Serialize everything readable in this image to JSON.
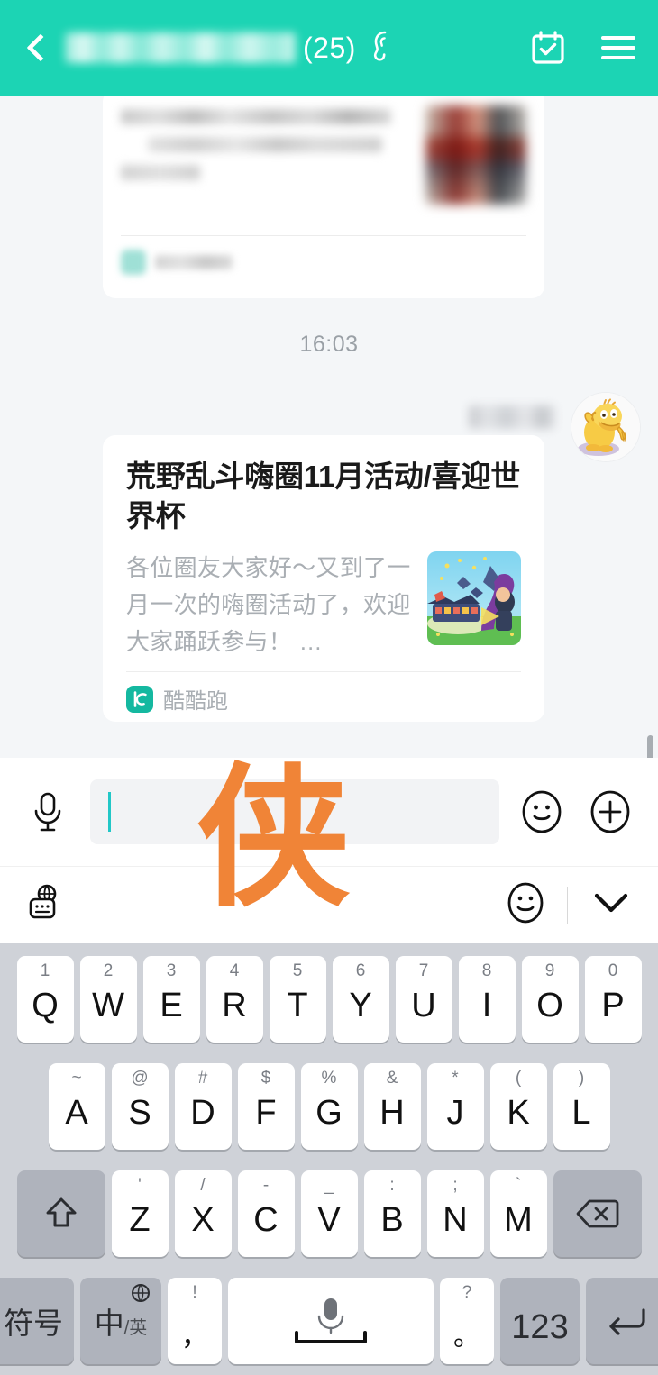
{
  "header": {
    "back_icon": "back-chevron-icon",
    "title_redacted": "",
    "member_count": "(25)",
    "ear_icon": "ear-icon",
    "calendar_icon": "calendar-check-icon",
    "menu_icon": "hamburger-menu-icon",
    "background_color": "#1CD4B4"
  },
  "chat": {
    "timestamp": "16:03",
    "blurred_card": {
      "redacted": "",
      "source_redacted": ""
    },
    "sender_name_redacted": "",
    "avatar_icon": "psyduck-avatar",
    "link_card": {
      "title": "荒野乱斗嗨圈11月活动/喜迎世界杯",
      "description": "各位圈友大家好～又到了一月一次的嗨圈活动了，欢迎大家踊跃参与！ …",
      "thumbnail_icon": "brawl-stars-thumbnail",
      "source_icon": "kukupao-icon",
      "source_name": "酷酷跑",
      "source_icon_color": "#14B8A0"
    }
  },
  "input_bar": {
    "mic_icon": "microphone-icon",
    "input_value": "",
    "input_placeholder": "",
    "emoji_icon": "smiley-face-icon",
    "plus_icon": "plus-circle-icon",
    "caret_color": "#22C7C7"
  },
  "watermark": {
    "text": "侠",
    "color": "#F08437"
  },
  "keyboard_toolbar": {
    "globe_keyboard_icon": "globe-keyboard-icon",
    "emoji_icon": "smiley-face-icon",
    "collapse_icon": "chevron-down-icon"
  },
  "keyboard": {
    "background_color": "#CFD2D8",
    "row1": [
      {
        "main": "Q",
        "sup": "1"
      },
      {
        "main": "W",
        "sup": "2"
      },
      {
        "main": "E",
        "sup": "3"
      },
      {
        "main": "R",
        "sup": "4"
      },
      {
        "main": "T",
        "sup": "5"
      },
      {
        "main": "Y",
        "sup": "6"
      },
      {
        "main": "U",
        "sup": "7"
      },
      {
        "main": "I",
        "sup": "8"
      },
      {
        "main": "O",
        "sup": "9"
      },
      {
        "main": "P",
        "sup": "0"
      }
    ],
    "row2": [
      {
        "main": "A",
        "sup": "~"
      },
      {
        "main": "S",
        "sup": "@"
      },
      {
        "main": "D",
        "sup": "#"
      },
      {
        "main": "F",
        "sup": "$"
      },
      {
        "main": "G",
        "sup": "%"
      },
      {
        "main": "H",
        "sup": "&"
      },
      {
        "main": "J",
        "sup": "*"
      },
      {
        "main": "K",
        "sup": "("
      },
      {
        "main": "L",
        "sup": ")"
      }
    ],
    "row3": {
      "shift_icon": "shift-arrow-icon",
      "letters": [
        {
          "main": "Z",
          "sup": "'"
        },
        {
          "main": "X",
          "sup": "/"
        },
        {
          "main": "C",
          "sup": "-"
        },
        {
          "main": "V",
          "sup": "_"
        },
        {
          "main": "B",
          "sup": ":"
        },
        {
          "main": "N",
          "sup": ";"
        },
        {
          "main": "M",
          "sup": "`"
        }
      ],
      "backspace_icon": "backspace-icon"
    },
    "row4": {
      "symbol_key": "符号",
      "lang_key_main": "中",
      "lang_key_small": "/英",
      "lang_globe_icon": "globe-icon",
      "comma_sup": "!",
      "comma_main": "，",
      "space_icon": "microphone-icon",
      "period_sup": "?",
      "period_main": "。",
      "num_key": "123",
      "enter_icon": "enter-arrow-icon"
    }
  }
}
